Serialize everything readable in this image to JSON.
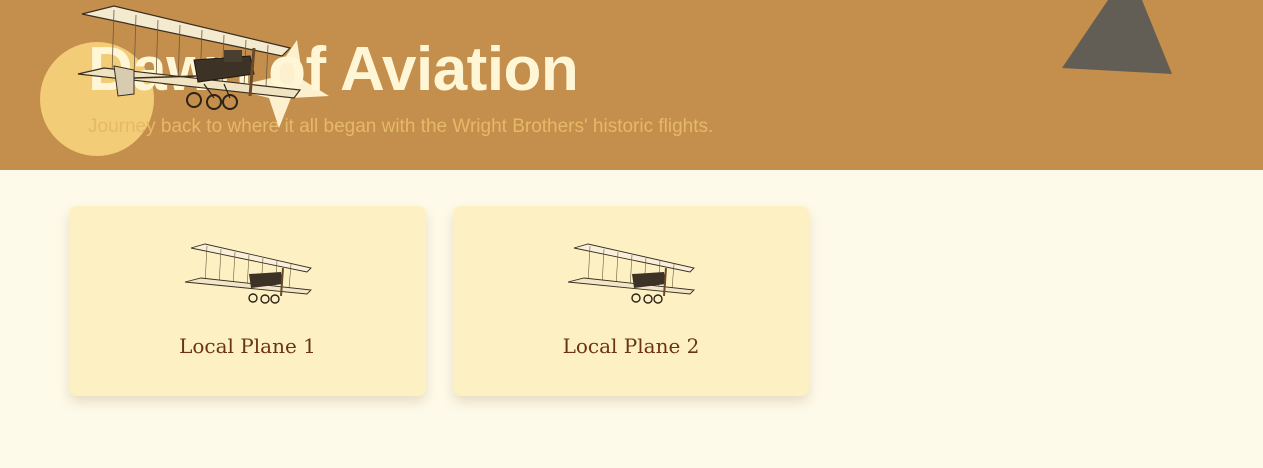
{
  "hero": {
    "title": "Dawn of Aviation",
    "subtitle": "Journey back to where it all began with the Wright Brothers' historic flights.",
    "colors": {
      "background": "#c48e4c",
      "title": "#fff6d6",
      "subtitle": "#e6b968",
      "circle": "#fbd77f",
      "triangle": "#625e55",
      "star": "#fff6d6"
    },
    "decoration_icons": [
      "circle-shape",
      "triangle-shape",
      "star-shape",
      "biplane-icon"
    ]
  },
  "cards": [
    {
      "label": "Local Plane 1",
      "icon": "biplane-icon"
    },
    {
      "label": "Local Plane 2",
      "icon": "biplane-icon"
    }
  ],
  "colors": {
    "page_background": "#fefae9",
    "card_background": "#fdf1c4",
    "card_text": "#6b3410"
  }
}
